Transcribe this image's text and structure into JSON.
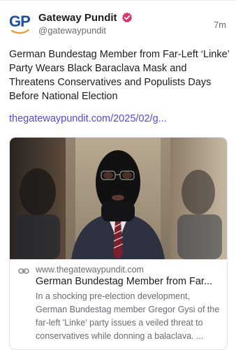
{
  "post": {
    "author_name": "Gateway Pundit",
    "author_handle": "@gatewaypundit",
    "avatar_text": "GP",
    "timestamp": "7m",
    "text": "German Bundestag Member from Far-Left ‘Linke’ Party Wears Black Baraclava Mask and Threatens Conservatives and Populists Days Before National Election",
    "link_text": "thegatewaypundit.com/2025/02/g..."
  },
  "card": {
    "image_icon": "man-in-black-balaclava-photo",
    "domain": "www.thegatewaypundit.com",
    "title": "German Bundestag Member from Far...",
    "description": "In a shocking pre-election development, German Bundestag member Gregor Gysi of the far-left 'Linke' party issues a veiled threat to conservatives while donning a balaclava. ..."
  },
  "colors": {
    "link": "#5a47d6",
    "verified_badge": "#d7366f",
    "avatar_brand": "#1f4f9a",
    "avatar_swoosh": "#e89a2a"
  },
  "icons": {
    "verified": "verified-badge-icon",
    "link": "link-icon"
  }
}
